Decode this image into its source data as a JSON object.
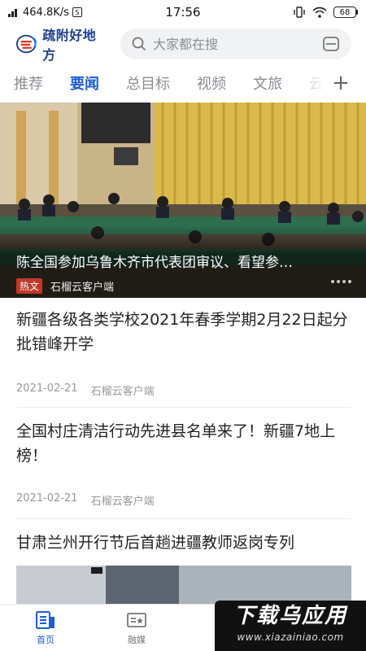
{
  "status_bar": {
    "net_speed": "464.8K/s",
    "time": "17:56",
    "battery": "68"
  },
  "header": {
    "logo_text": "疏附好地方",
    "search_placeholder": "大家都在搜"
  },
  "tabs": [
    {
      "label": "推荐"
    },
    {
      "label": "要闻",
      "active": true
    },
    {
      "label": "总目标"
    },
    {
      "label": "视频"
    },
    {
      "label": "文旅"
    },
    {
      "label": "云"
    }
  ],
  "hero": {
    "title": "陈全国参加乌鲁木齐市代表团审议、看望参…",
    "badge": "热文",
    "source": "石榴云客户端"
  },
  "articles": [
    {
      "title": "新疆各级各类学校2021年春季学期2月22日起分批错峰开学",
      "date": "2021-02-21",
      "source": "石榴云客户端"
    },
    {
      "title": "全国村庄清洁行动先进县名单来了！新疆7地上榜！",
      "date": "2021-02-21",
      "source": "石榴云客户端"
    },
    {
      "title": "甘肃兰州开行节后首趟进疆教师返岗专列"
    }
  ],
  "bottom_nav": [
    {
      "label": "首页",
      "active": true
    },
    {
      "label": "融媒"
    }
  ],
  "watermark": {
    "line1": "下载乌应用",
    "line2": "www.xiazainiao.com"
  },
  "colors": {
    "accent": "#1d5dd0",
    "brand": "#1d3f8c",
    "hot_badge": "#c0392b"
  }
}
